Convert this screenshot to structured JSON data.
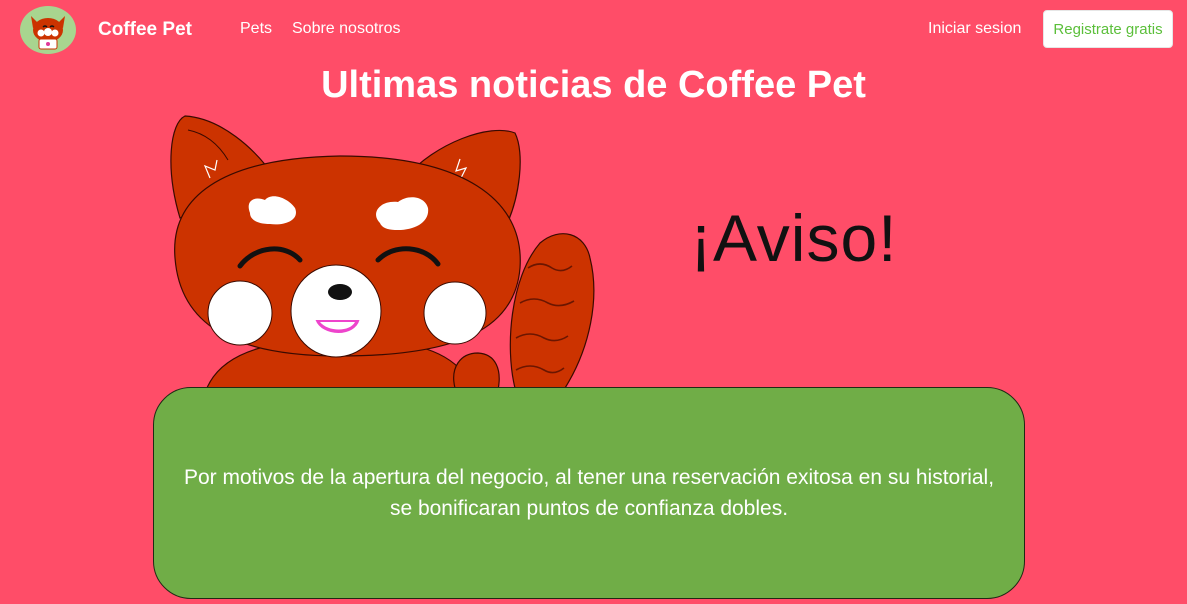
{
  "navbar": {
    "brand": "Coffee Pet",
    "links": [
      "Pets",
      "Sobre nosotros"
    ],
    "login": "Iniciar sesion",
    "signup": "Registrate gratis"
  },
  "main": {
    "title": "Ultimas noticias de Coffee Pet",
    "heading": "¡Aviso!",
    "notice": "Por motivos de la apertura del negocio, al tener una reservación exitosa en su historial, se bonificaran puntos de confianza dobles."
  },
  "colors": {
    "background": "#ff4d68",
    "card": "#70ad47",
    "signup_text": "#5bbf3a",
    "panda_fur": "#cc3300"
  },
  "icons": {
    "logo": "red-panda-coffee-logo",
    "illustration": "red-panda-mascot"
  }
}
